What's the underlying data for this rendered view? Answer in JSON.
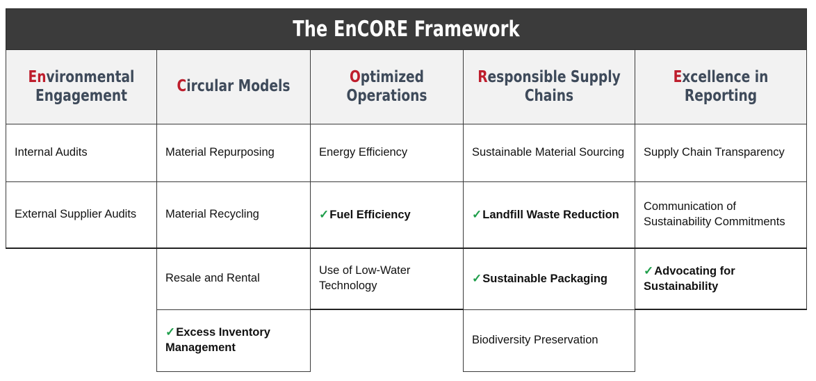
{
  "title": "The EnCORE Framework",
  "colors": {
    "title_bar_bg": "#3B3B3B",
    "title_text": "#FFFFFF",
    "header_bg": "#F2F2F2",
    "header_text": "#3E4A5A",
    "accent_letter": "#BE1E2D",
    "check_green": "#1E9E4A",
    "body_text": "#111111",
    "border": "#3A3A3A"
  },
  "columns": [
    {
      "accent": "En",
      "rest": "vironmental",
      "line2": "Engagement"
    },
    {
      "accent": "C",
      "rest": "ircular Models",
      "line2": ""
    },
    {
      "accent": "O",
      "rest": "ptimized",
      "line2": "Operations"
    },
    {
      "accent": "R",
      "rest": "esponsible Supply",
      "line2": "Chains"
    },
    {
      "accent": "E",
      "rest": "xcellence in",
      "line2": "Reporting"
    }
  ],
  "rows": [
    {
      "cells": [
        {
          "text": "Internal Audits",
          "checked": false,
          "empty": false
        },
        {
          "text": "Material Repurposing",
          "checked": false,
          "empty": false
        },
        {
          "text": "Energy Efficiency",
          "checked": false,
          "empty": false
        },
        {
          "text": "Sustainable Material Sourcing",
          "checked": false,
          "empty": false
        },
        {
          "text": "Supply Chain Transparency",
          "checked": false,
          "empty": false
        }
      ]
    },
    {
      "cells": [
        {
          "text": "External Supplier Audits",
          "checked": false,
          "empty": false
        },
        {
          "text": "Material Recycling",
          "checked": false,
          "empty": false
        },
        {
          "text": "Fuel Efficiency",
          "checked": true,
          "empty": false
        },
        {
          "text": "Landfill Waste Reduction",
          "checked": true,
          "empty": false
        },
        {
          "text": "Communication of Sustainability Commitments",
          "checked": false,
          "empty": false
        }
      ]
    },
    {
      "cells": [
        {
          "text": "",
          "checked": false,
          "empty": true
        },
        {
          "text": "Resale and Rental",
          "checked": false,
          "empty": false
        },
        {
          "text": "Use of Low-Water Technology",
          "checked": false,
          "empty": false
        },
        {
          "text": "Sustainable Packaging",
          "checked": true,
          "empty": false
        },
        {
          "text": "Advocating for Sustainability",
          "checked": true,
          "empty": false
        }
      ]
    },
    {
      "cells": [
        {
          "text": "",
          "checked": false,
          "empty": true
        },
        {
          "text": "Excess Inventory Management",
          "checked": true,
          "empty": false
        },
        {
          "text": "",
          "checked": false,
          "empty": true
        },
        {
          "text": "Biodiversity Preservation",
          "checked": false,
          "empty": false
        },
        {
          "text": "",
          "checked": false,
          "empty": true
        }
      ]
    }
  ],
  "check_glyph": "✓"
}
